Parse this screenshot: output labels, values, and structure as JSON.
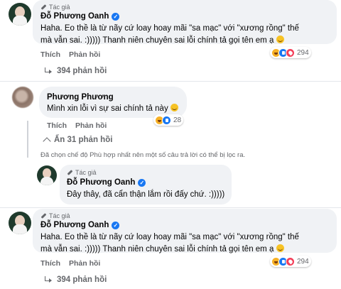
{
  "comments": [
    {
      "author_badge": "Tác giả",
      "name": "Đỗ Phương Oanh",
      "text_line1": "Haha. Eo thề là từ nãy cứ loay hoay mãi \"sa mạc\" với \"xương rồng\" thế",
      "text_line2": "mà vẫn sai. :))))) Thanh niên chuyên sai lỗi chính tả gọi tên em ạ",
      "like_label": "Thích",
      "reply_label": "Phản hồi",
      "reaction_count": "294",
      "replies_label": "394 phản hồi"
    },
    {
      "name": "Phương Phương",
      "text": "Mình xin lỗi vì sự sai chính tả này",
      "like_label": "Thích",
      "reply_label": "Phản hồi",
      "reaction_count": "28",
      "hide_replies_label": "Ẩn 31 phản hồi"
    }
  ],
  "filter_notice": "Đã chọn chế độ Phù hợp nhất nên một số câu trả lời có thể bị lọc ra.",
  "nested_reply": {
    "author_badge": "Tác giả",
    "name": "Đỗ Phương Oanh",
    "text": "Đây thây, đã cẩn thận lắm rồi đấy chứ. :)))))"
  },
  "repeat_comment": {
    "author_badge": "Tác giả",
    "name": "Đỗ Phương Oanh",
    "text_line1": "Haha. Eo thề là từ nãy cứ loay hoay mãi \"sa mạc\" với \"xương rồng\" thế",
    "text_line2": "mà vẫn sai. :))))) Thanh niên chuyên sai lỗi chính tả gọi tên em ạ",
    "like_label": "Thích",
    "reply_label": "Phản hồi",
    "reaction_count": "294",
    "replies_label": "394 phản hồi"
  },
  "colors": {
    "bubble": "#f0f2f5",
    "secondary_text": "#65676b",
    "verified": "#1877f2"
  }
}
